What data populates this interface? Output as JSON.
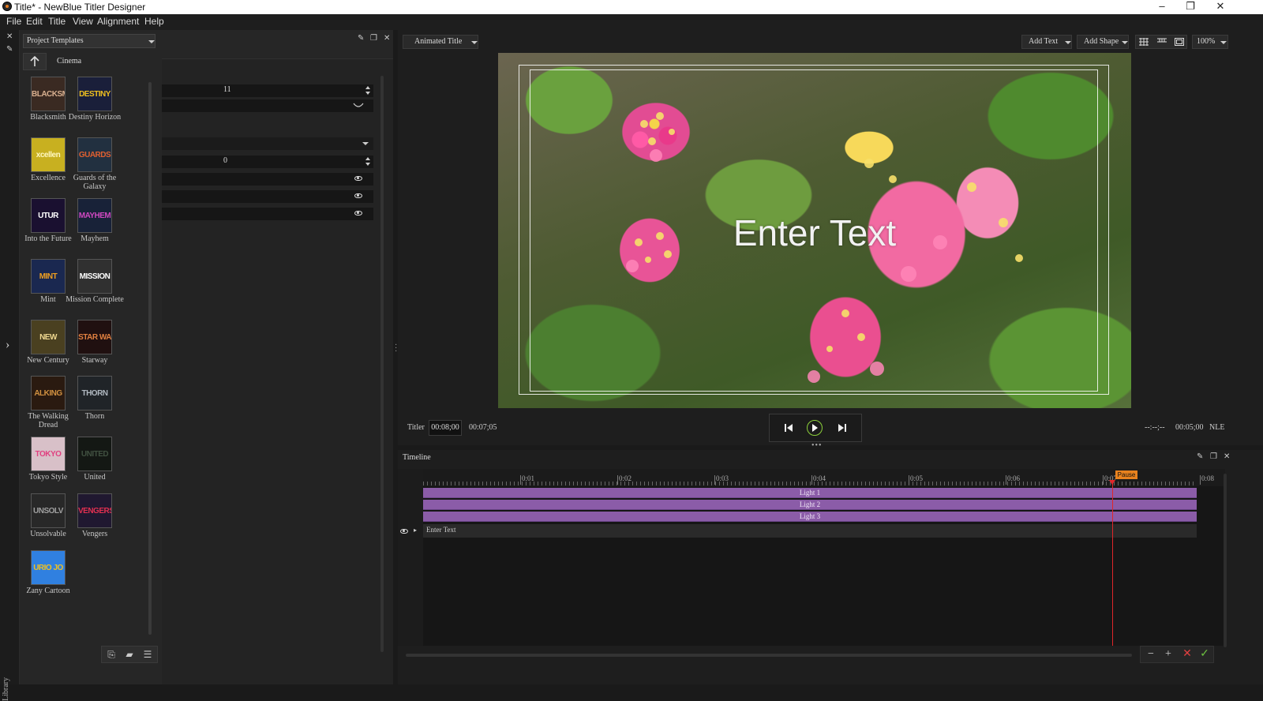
{
  "window": {
    "title": "Title* - NewBlue Titler Designer",
    "controls": {
      "minimize": "–",
      "restore": "❐",
      "close": "✕"
    }
  },
  "menu": [
    "File",
    "Edit",
    "Title",
    "View",
    "Alignment",
    "Help"
  ],
  "library": {
    "dropdown_label": "Project Templates",
    "category": "Cinema",
    "side_label": "Library",
    "templates": [
      {
        "name": "Blacksmith",
        "thumb": "BLACKSMITH",
        "bg": "#3a2a22",
        "fg": "#d8b090"
      },
      {
        "name": "Destiny Horizon",
        "thumb": "DESTINY HORIZO",
        "bg": "#1a1f3a",
        "fg": "#f0c020"
      },
      {
        "name": "Excellence",
        "thumb": "xcellen",
        "bg": "#c8b020",
        "fg": "#fff8c0"
      },
      {
        "name": "Guards of the Galaxy",
        "thumb": "GUARDS GALAXY",
        "bg": "#223040",
        "fg": "#e06030"
      },
      {
        "name": "Into the Future",
        "thumb": "UTUR",
        "bg": "#1a1030",
        "fg": "#ffffff"
      },
      {
        "name": "Mayhem",
        "thumb": "MAYHEM",
        "bg": "#182238",
        "fg": "#d048c0"
      },
      {
        "name": "Mint",
        "thumb": "MINT",
        "bg": "#1a2850",
        "fg": "#f0a020"
      },
      {
        "name": "Mission Complete",
        "thumb": "MISSION",
        "bg": "#303030",
        "fg": "#ffffff"
      },
      {
        "name": "New Century",
        "thumb": "NEW ENTUR",
        "bg": "#4a4020",
        "fg": "#f0d890"
      },
      {
        "name": "Starway",
        "thumb": "STAR WA",
        "bg": "#201010",
        "fg": "#e08040"
      },
      {
        "name": "The Walking Dread",
        "thumb": "ALKING DREA",
        "bg": "#2a1a10",
        "fg": "#d09040"
      },
      {
        "name": "Thorn",
        "thumb": "THORN",
        "bg": "#202428",
        "fg": "#b0b8c0"
      },
      {
        "name": "Tokyo Style",
        "thumb": "TOKYO",
        "bg": "#d8c0c8",
        "fg": "#e04080"
      },
      {
        "name": "United",
        "thumb": "UNITED",
        "bg": "#141814",
        "fg": "#405040"
      },
      {
        "name": "Unsolvable",
        "thumb": "UNSOLV",
        "bg": "#282828",
        "fg": "#a0a0a0"
      },
      {
        "name": "Vengers",
        "thumb": "VENGERS",
        "bg": "#201830",
        "fg": "#e03050"
      },
      {
        "name": "Zany Cartoon",
        "thumb": "URIO JO",
        "bg": "#3080e0",
        "fg": "#f0c020"
      }
    ]
  },
  "properties": {
    "row1_value": "11",
    "row4_value": "0"
  },
  "preview": {
    "animation_type": "Animated Title",
    "add_text": "Add Text",
    "add_shape": "Add Shape",
    "zoom": "100%",
    "canvas_text": "Enter Text"
  },
  "transport": {
    "titler_label": "Titler",
    "current_time": "00:08;00",
    "total_time": "00:07;05",
    "mark_in": "--:--;--",
    "nle_time": "00:05;00",
    "nle_label": "NLE"
  },
  "timeline": {
    "title": "Timeline",
    "ticks": [
      "0:01",
      "0:02",
      "0:03",
      "0:04",
      "0:05",
      "0:06",
      "0:07",
      "0:08"
    ],
    "tracks": [
      "Light 1",
      "Light 2",
      "Light 3"
    ],
    "text_track": "Enter Text",
    "pause_marker": "Pause",
    "playhead_time_s": 7.1
  }
}
